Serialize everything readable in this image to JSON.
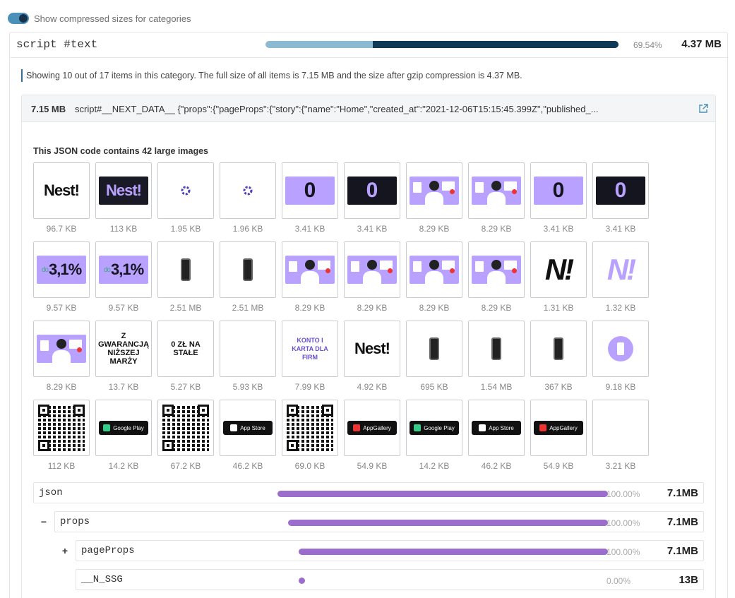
{
  "toggle": {
    "label": "Show compressed sizes for categories",
    "on": true
  },
  "category": {
    "name": "script #text",
    "compressed_fraction": 0.6954,
    "percent": "69.54%",
    "size": "4.37 MB",
    "colors": {
      "total": "#8bbad2",
      "compressed": "#0e3a55"
    }
  },
  "info": "Showing 10 out of 17 items in this category. The full size of all items is 7.15 MB and the size after gzip compression is 4.37 MB.",
  "item": {
    "size": "7.15 MB",
    "code": "script#__NEXT_DATA__ {\"props\":{\"pageProps\":{\"story\":{\"name\":\"Home\",\"created_at\":\"2021-12-06T15:15:45.399Z\",\"published_...",
    "open_icon": "external-link-icon",
    "images_title": "This JSON code contains 42 large images",
    "images": [
      {
        "kind": "nest-logo",
        "label": "96.7 KB",
        "text": "Nest!"
      },
      {
        "kind": "nest-logo-dark",
        "label": "113 KB",
        "text": "Nest!"
      },
      {
        "kind": "spinner",
        "label": "1.95 KB"
      },
      {
        "kind": "spinner",
        "label": "1.96 KB"
      },
      {
        "kind": "zero-light",
        "label": "3.41 KB",
        "text": "0"
      },
      {
        "kind": "zero-dark",
        "label": "3.41 KB",
        "text": "0"
      },
      {
        "kind": "promo",
        "label": "8.29 KB"
      },
      {
        "kind": "promo",
        "label": "8.29 KB"
      },
      {
        "kind": "zero-light",
        "label": "3.41 KB",
        "text": "0"
      },
      {
        "kind": "zero-dark",
        "label": "3.41 KB",
        "text": "0"
      },
      {
        "kind": "percent",
        "label": "9.57 KB",
        "text": "3,1%",
        "pre": "do"
      },
      {
        "kind": "percent",
        "label": "9.57 KB",
        "text": "3,1%",
        "pre": "do"
      },
      {
        "kind": "phone",
        "label": "2.51 MB"
      },
      {
        "kind": "phone",
        "label": "2.51 MB"
      },
      {
        "kind": "promo",
        "label": "8.29 KB"
      },
      {
        "kind": "promo",
        "label": "8.29 KB"
      },
      {
        "kind": "promo",
        "label": "8.29 KB"
      },
      {
        "kind": "promo",
        "label": "8.29 KB"
      },
      {
        "kind": "n-logo",
        "label": "1.31 KB",
        "text": "N!"
      },
      {
        "kind": "n-logo-light",
        "label": "1.32 KB",
        "text": "N!"
      },
      {
        "kind": "promo",
        "label": "8.29 KB"
      },
      {
        "kind": "text",
        "label": "13.7 KB",
        "text": "Z GWARANCJĄ NIŻSZEJ MARŻY"
      },
      {
        "kind": "text",
        "label": "5.27 KB",
        "text": "0 ZŁ NA STAŁE"
      },
      {
        "kind": "blank",
        "label": "5.93 KB"
      },
      {
        "kind": "text-purple",
        "label": "7.99 KB",
        "text": "KONTO I KARTA DLA FIRM"
      },
      {
        "kind": "nest-logo",
        "label": "4.92 KB",
        "text": "Nest!"
      },
      {
        "kind": "phone",
        "label": "695 KB"
      },
      {
        "kind": "phone",
        "label": "1.54 MB"
      },
      {
        "kind": "phone",
        "label": "367 KB"
      },
      {
        "kind": "circle",
        "label": "9.18 KB"
      },
      {
        "kind": "qr",
        "label": "112 KB"
      },
      {
        "kind": "badge",
        "label": "14.2 KB",
        "text": "Google Play"
      },
      {
        "kind": "qr",
        "label": "67.2 KB"
      },
      {
        "kind": "badge",
        "label": "46.2 KB",
        "text": "App Store"
      },
      {
        "kind": "qr",
        "label": "69.0 KB"
      },
      {
        "kind": "badge-red",
        "label": "54.9 KB",
        "text": "AppGallery"
      },
      {
        "kind": "badge",
        "label": "14.2 KB",
        "text": "Google Play"
      },
      {
        "kind": "badge",
        "label": "46.2 KB",
        "text": "App Store"
      },
      {
        "kind": "badge-red",
        "label": "54.9 KB",
        "text": "AppGallery"
      },
      {
        "kind": "blank",
        "label": "3.21 KB"
      }
    ]
  },
  "tree": [
    {
      "name": "json",
      "toggle": "",
      "percent": "100.00%",
      "fraction": 1.0,
      "size": "7.1MB",
      "depth": 0
    },
    {
      "name": "props",
      "toggle": "−",
      "percent": "100.00%",
      "fraction": 1.0,
      "size": "7.1MB",
      "depth": 1
    },
    {
      "name": "pageProps",
      "toggle": "+",
      "percent": "100.00%",
      "fraction": 1.0,
      "size": "7.1MB",
      "depth": 2
    },
    {
      "name": "__N_SSG",
      "toggle": "",
      "percent": "0.00%",
      "fraction": 0.0,
      "size": "13B",
      "depth": 2
    }
  ],
  "colors": {
    "accent": "#4a90b8",
    "tree_bar": "#9b6dcc",
    "brand_purple": "#b9a2ff"
  }
}
